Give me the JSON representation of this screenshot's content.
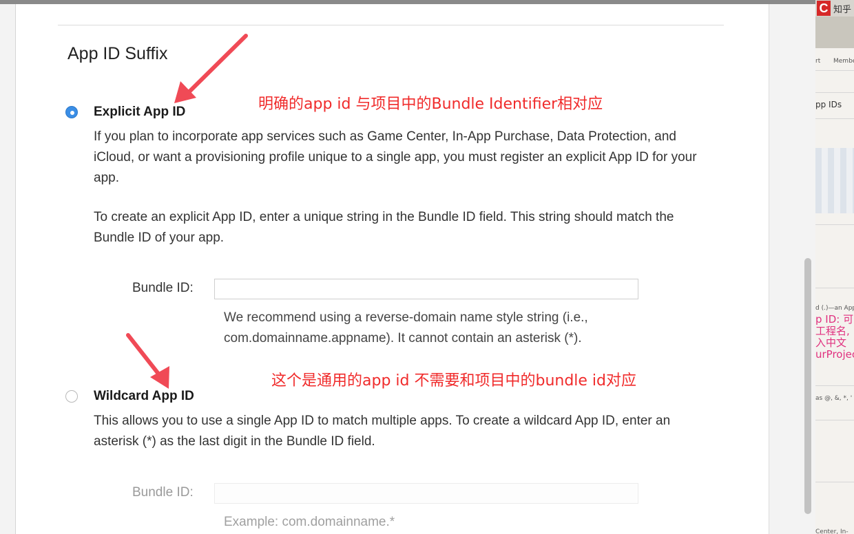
{
  "section": {
    "title": "App ID Suffix"
  },
  "explicit": {
    "title": "Explicit App ID",
    "selected": true,
    "paragraph1": "If you plan to incorporate app services such as Game Center, In-App Purchase, Data Protection, and iCloud, or want a provisioning profile unique to a single app, you must register an explicit App ID for your app.",
    "paragraph2": "To create an explicit App ID, enter a unique string in the Bundle ID field. This string should match the Bundle ID of your app.",
    "bundle_label": "Bundle ID:",
    "bundle_value": "",
    "hint": "We recommend using a reverse-domain name style string (i.e., com.domainname.appname). It cannot contain an asterisk (*)."
  },
  "wildcard": {
    "title": "Wildcard App ID",
    "selected": false,
    "paragraph": "This allows you to use a single App ID to match multiple apps. To create a wildcard App ID, enter an asterisk (*) as the last digit in the Bundle ID field.",
    "bundle_label": "Bundle ID:",
    "bundle_value": "",
    "hint": "Example: com.domainname.*"
  },
  "annotations": {
    "explicit_note": "明确的app id 与项目中的Bundle Identifier相对应",
    "wildcard_note": "这个是通用的app id 不需要和项目中的bundle id对应"
  },
  "background_window": {
    "brand_badge": "C",
    "brand_text": "知乎",
    "nav_left": "rt",
    "nav_right": "Member",
    "section_label": "pp IDs",
    "snippet_top": "d (.)—an App",
    "pink_lines": [
      "p ID: 可",
      "工程名,",
      "入中文",
      "urProjec"
    ],
    "snippet_chars": "as @, &, *, '",
    "snippet_bottom": "Center, In-"
  },
  "colors": {
    "accent": "#3a8ee6",
    "annotation": "#f02b2b",
    "arrow": "#f04a56"
  },
  "icons": {
    "arrow_explicit": "red-arrow-icon",
    "arrow_wildcard": "red-arrow-icon",
    "radio_checked": "radio-checked-icon",
    "radio_unchecked": "radio-unchecked-icon"
  }
}
